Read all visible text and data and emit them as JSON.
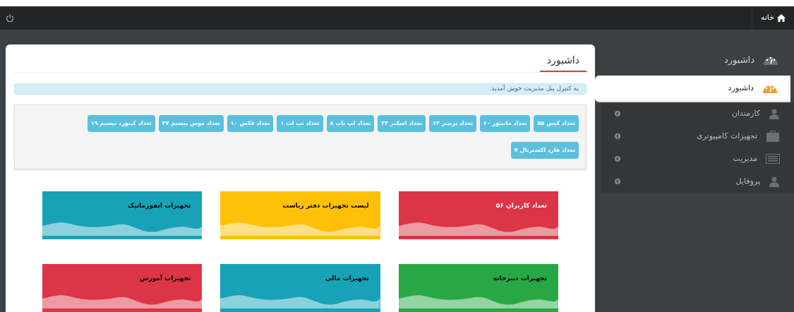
{
  "topbar": {
    "home_label": "خانه"
  },
  "sidebar": {
    "header": "داشبورد",
    "items": [
      {
        "label": "داشبورد",
        "kind": "gauge",
        "selected": true,
        "has_arrow": false
      },
      {
        "label": "کارمندان",
        "kind": "user",
        "selected": false,
        "has_arrow": true
      },
      {
        "label": "تجهیزات کامپیوتری",
        "kind": "case",
        "selected": false,
        "has_arrow": true
      },
      {
        "label": "مدیریت",
        "kind": "list",
        "selected": false,
        "has_arrow": true
      },
      {
        "label": "پروفایل",
        "kind": "user",
        "selected": false,
        "has_arrow": true
      }
    ]
  },
  "page": {
    "title": "داشبورد",
    "alert": "به کنترل پنل مدیریت خوش آمدید.",
    "counts": [
      "تعداد کیس ۵۵",
      "تعداد مانیتور ۶۰",
      "تعداد پرینتر ۶۲",
      "تعداد اسکنر ۲۳",
      "تعداد لپ تاپ ۸",
      "تعداد تب لت ۱",
      "تعداد فکس ۱۰",
      "تعداد موس بیسیم ۲۷",
      "تعداد کیبورد بیسیم ۱۹",
      "تعداد هارد اکسترنال ۷"
    ],
    "cards": [
      {
        "title": "تعداد کاربران ۵۶",
        "color": "#dc3545",
        "light_text": true
      },
      {
        "title": "لیست تجهیزات دفتر ریاست",
        "color": "#ffc107",
        "light_text": false
      },
      {
        "title": "تجهیزات انفورماتیک",
        "color": "#17a2b8",
        "light_text": false
      },
      {
        "title": "تجهیزات دبیرخانه",
        "color": "#28a745",
        "light_text": false
      },
      {
        "title": "تجهیزات مالی",
        "color": "#17a2b8",
        "light_text": false
      },
      {
        "title": "تجهیزات آموزش",
        "color": "#dc3545",
        "light_text": false
      }
    ]
  }
}
